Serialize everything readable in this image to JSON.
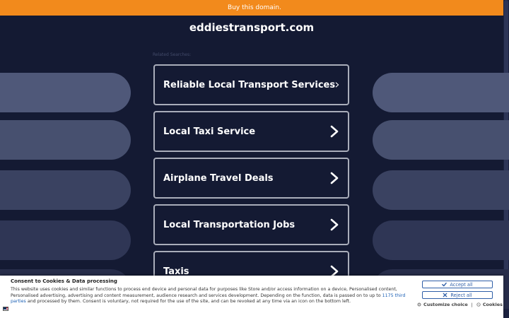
{
  "banner": {
    "text": "Buy this domain."
  },
  "domain": {
    "title": "eddiestransport.com"
  },
  "related": {
    "label": "Related Searches:",
    "links": [
      "Reliable Local Transport Services",
      "Local Taxi Service",
      "Airplane Travel Deals",
      "Local Transportation Jobs",
      "Taxis"
    ]
  },
  "colors": {
    "background": "#141a33",
    "banner": "#f28a1c",
    "link_border": "#a9adba",
    "accent_blue": "#2f5fa8"
  },
  "consent": {
    "title": "Consent to Cookies & Data processing",
    "text_before_link": "This website uses cookies and similar functions to process end device and personal data for purposes like Store and/or access information on a device, Personalised content, Personalised advertising, advertising and content measurement, audience research and services development. Depending on the function, data is passed on to up to ",
    "third_parties_link": "1175 third parties",
    "text_after_link": " and processed by them. Consent is voluntary, not required for the use of the site, and can be revoked at any time via an icon on the bottom left.",
    "accept_label": "Accept all",
    "reject_label": "Reject all",
    "customize_label": "Customize choice",
    "separator": "|",
    "cookies_label": "Cookies",
    "flag_icon": "us-flag-icon"
  }
}
